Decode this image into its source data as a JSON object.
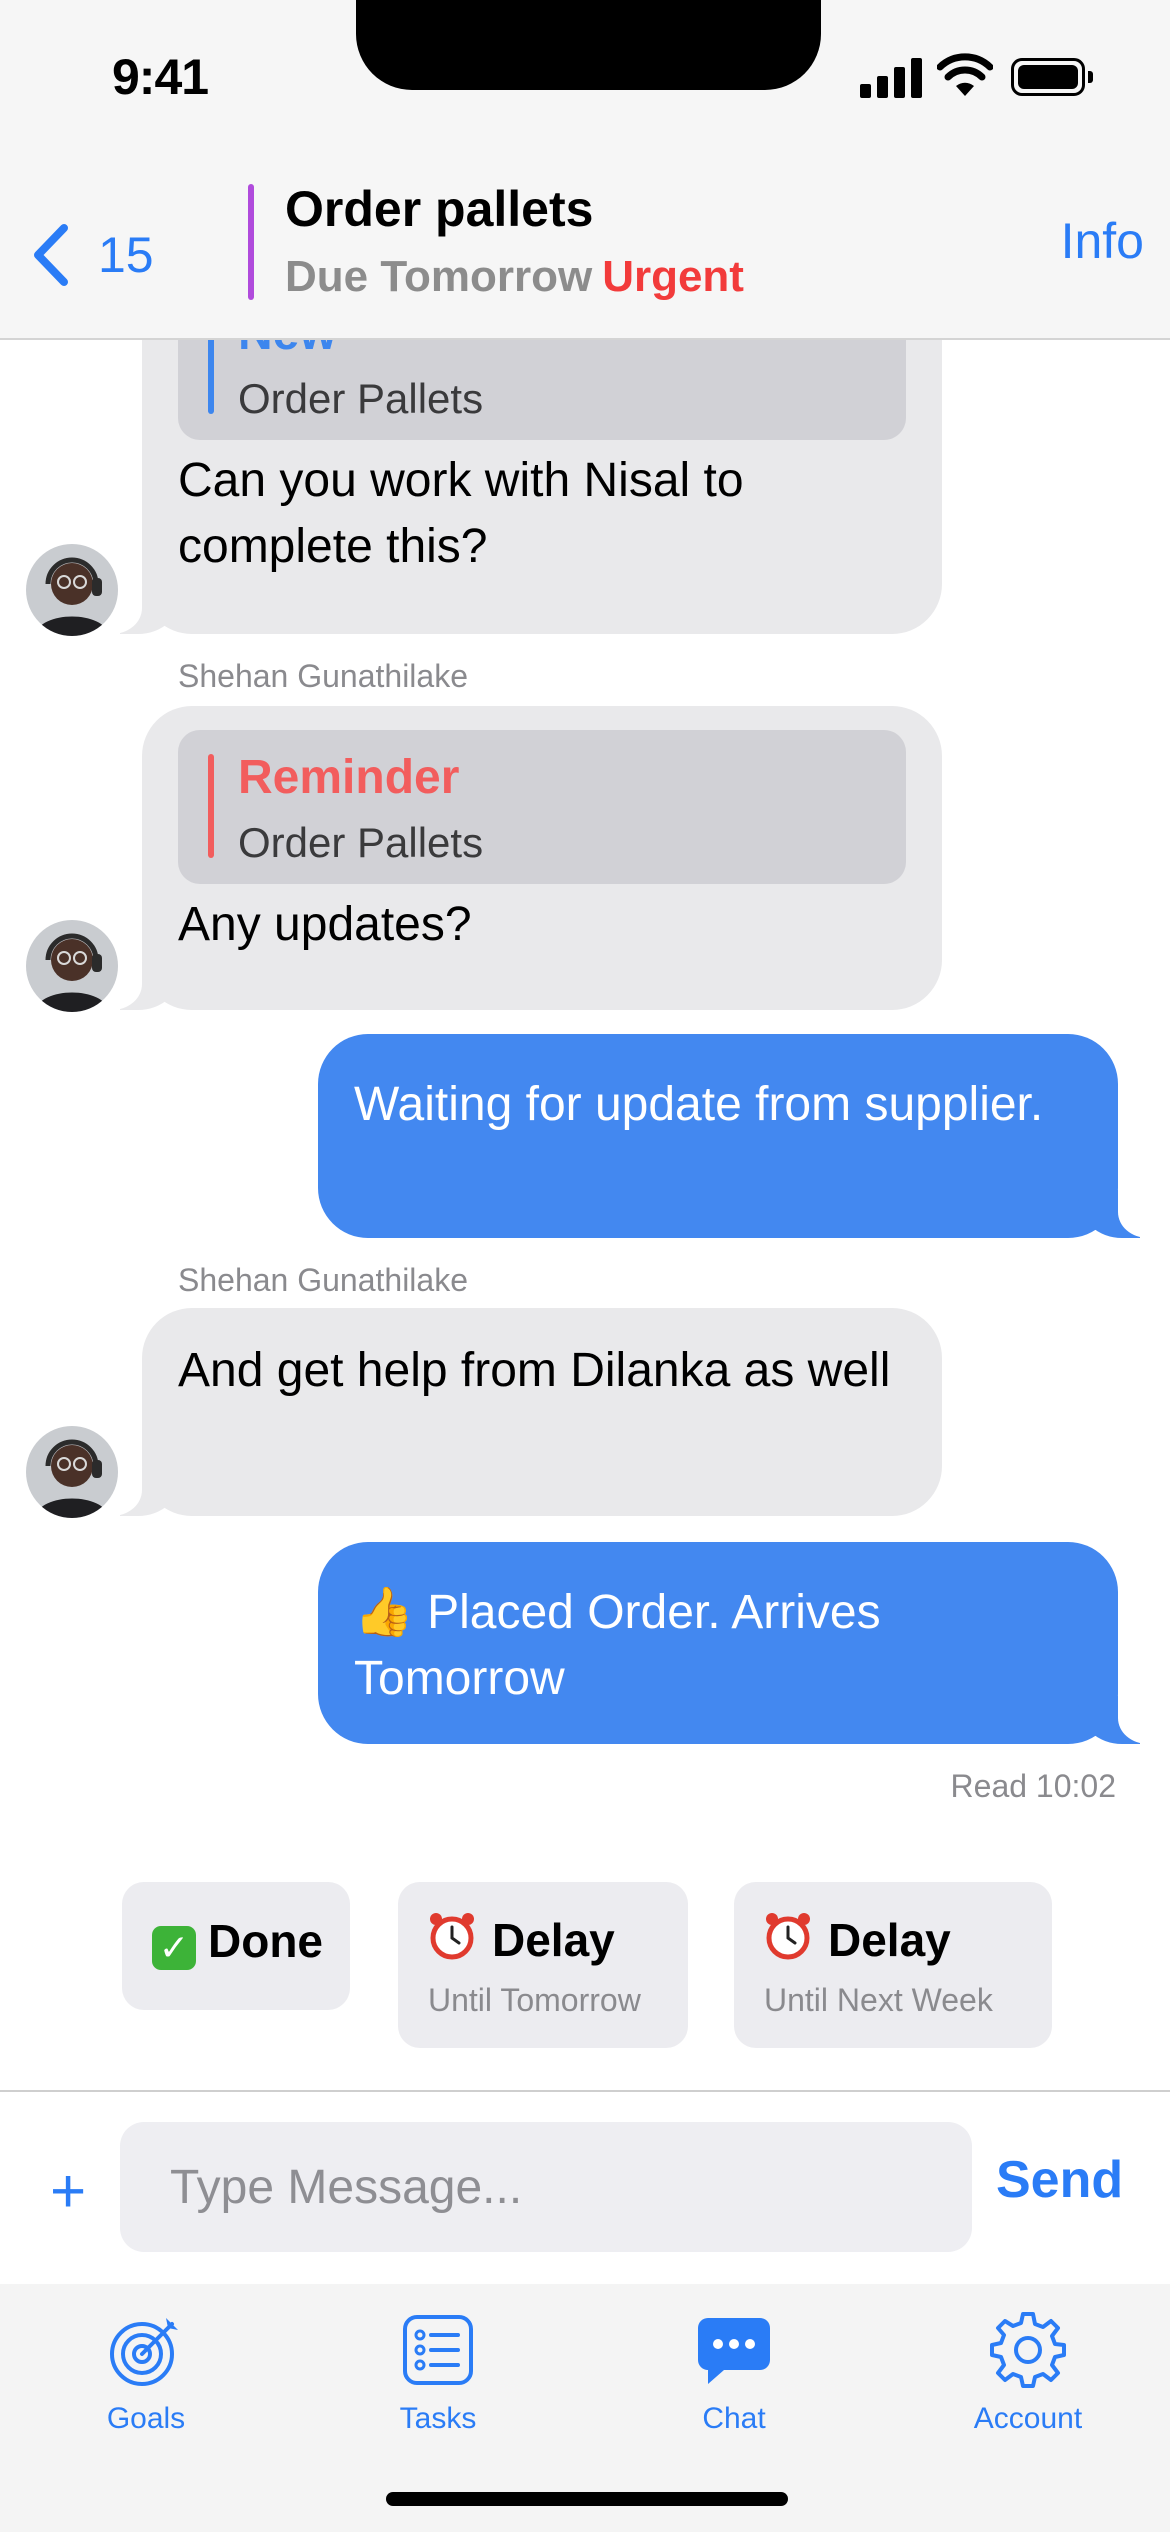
{
  "status_bar": {
    "time": "9:41"
  },
  "header": {
    "back_count": "15",
    "title": "Order pallets",
    "due": "Due Tomorrow",
    "priority": "Urgent",
    "info_label": "Info"
  },
  "messages": [
    {
      "direction": "incoming",
      "quote_tag": "New",
      "quote_text": "Order Pallets",
      "text": "Can you work with Nisal to complete this?"
    },
    {
      "direction": "incoming",
      "sender": "Shehan Gunathilake",
      "quote_tag": "Reminder",
      "quote_text": "Order Pallets",
      "text": "Any updates?"
    },
    {
      "direction": "outgoing",
      "text": "Waiting for update from supplier."
    },
    {
      "direction": "incoming",
      "sender": "Shehan Gunathilake",
      "text": "And get help from Dilanka as well"
    },
    {
      "direction": "outgoing",
      "emoji": "👍",
      "text": "Placed Order. Arrives Tomorrow"
    }
  ],
  "read_receipt": "Read 10:02",
  "quick_actions": [
    {
      "icon": "check-mark-icon",
      "label": "Done"
    },
    {
      "icon": "alarm-clock-icon",
      "label": "Delay",
      "sub": "Until Tomorrow"
    },
    {
      "icon": "alarm-clock-icon",
      "label": "Delay",
      "sub": "Until Next Week"
    }
  ],
  "composer": {
    "plus": "+",
    "placeholder": "Type Message...",
    "send_label": "Send"
  },
  "tabs": [
    {
      "label": "Goals",
      "icon": "target-icon"
    },
    {
      "label": "Tasks",
      "icon": "checklist-icon"
    },
    {
      "label": "Chat",
      "icon": "chat-bubble-icon",
      "active": true
    },
    {
      "label": "Account",
      "icon": "gear-icon"
    }
  ],
  "colors": {
    "accent": "#2a7cf6",
    "outgoing_bubble": "#4388f0",
    "incoming_bubble": "#e9e9eb",
    "urgent": "#f23b3b",
    "quote_new": "#3d86ee",
    "quote_reminder": "#f25d5d",
    "task_marker": "#b04bdc"
  }
}
